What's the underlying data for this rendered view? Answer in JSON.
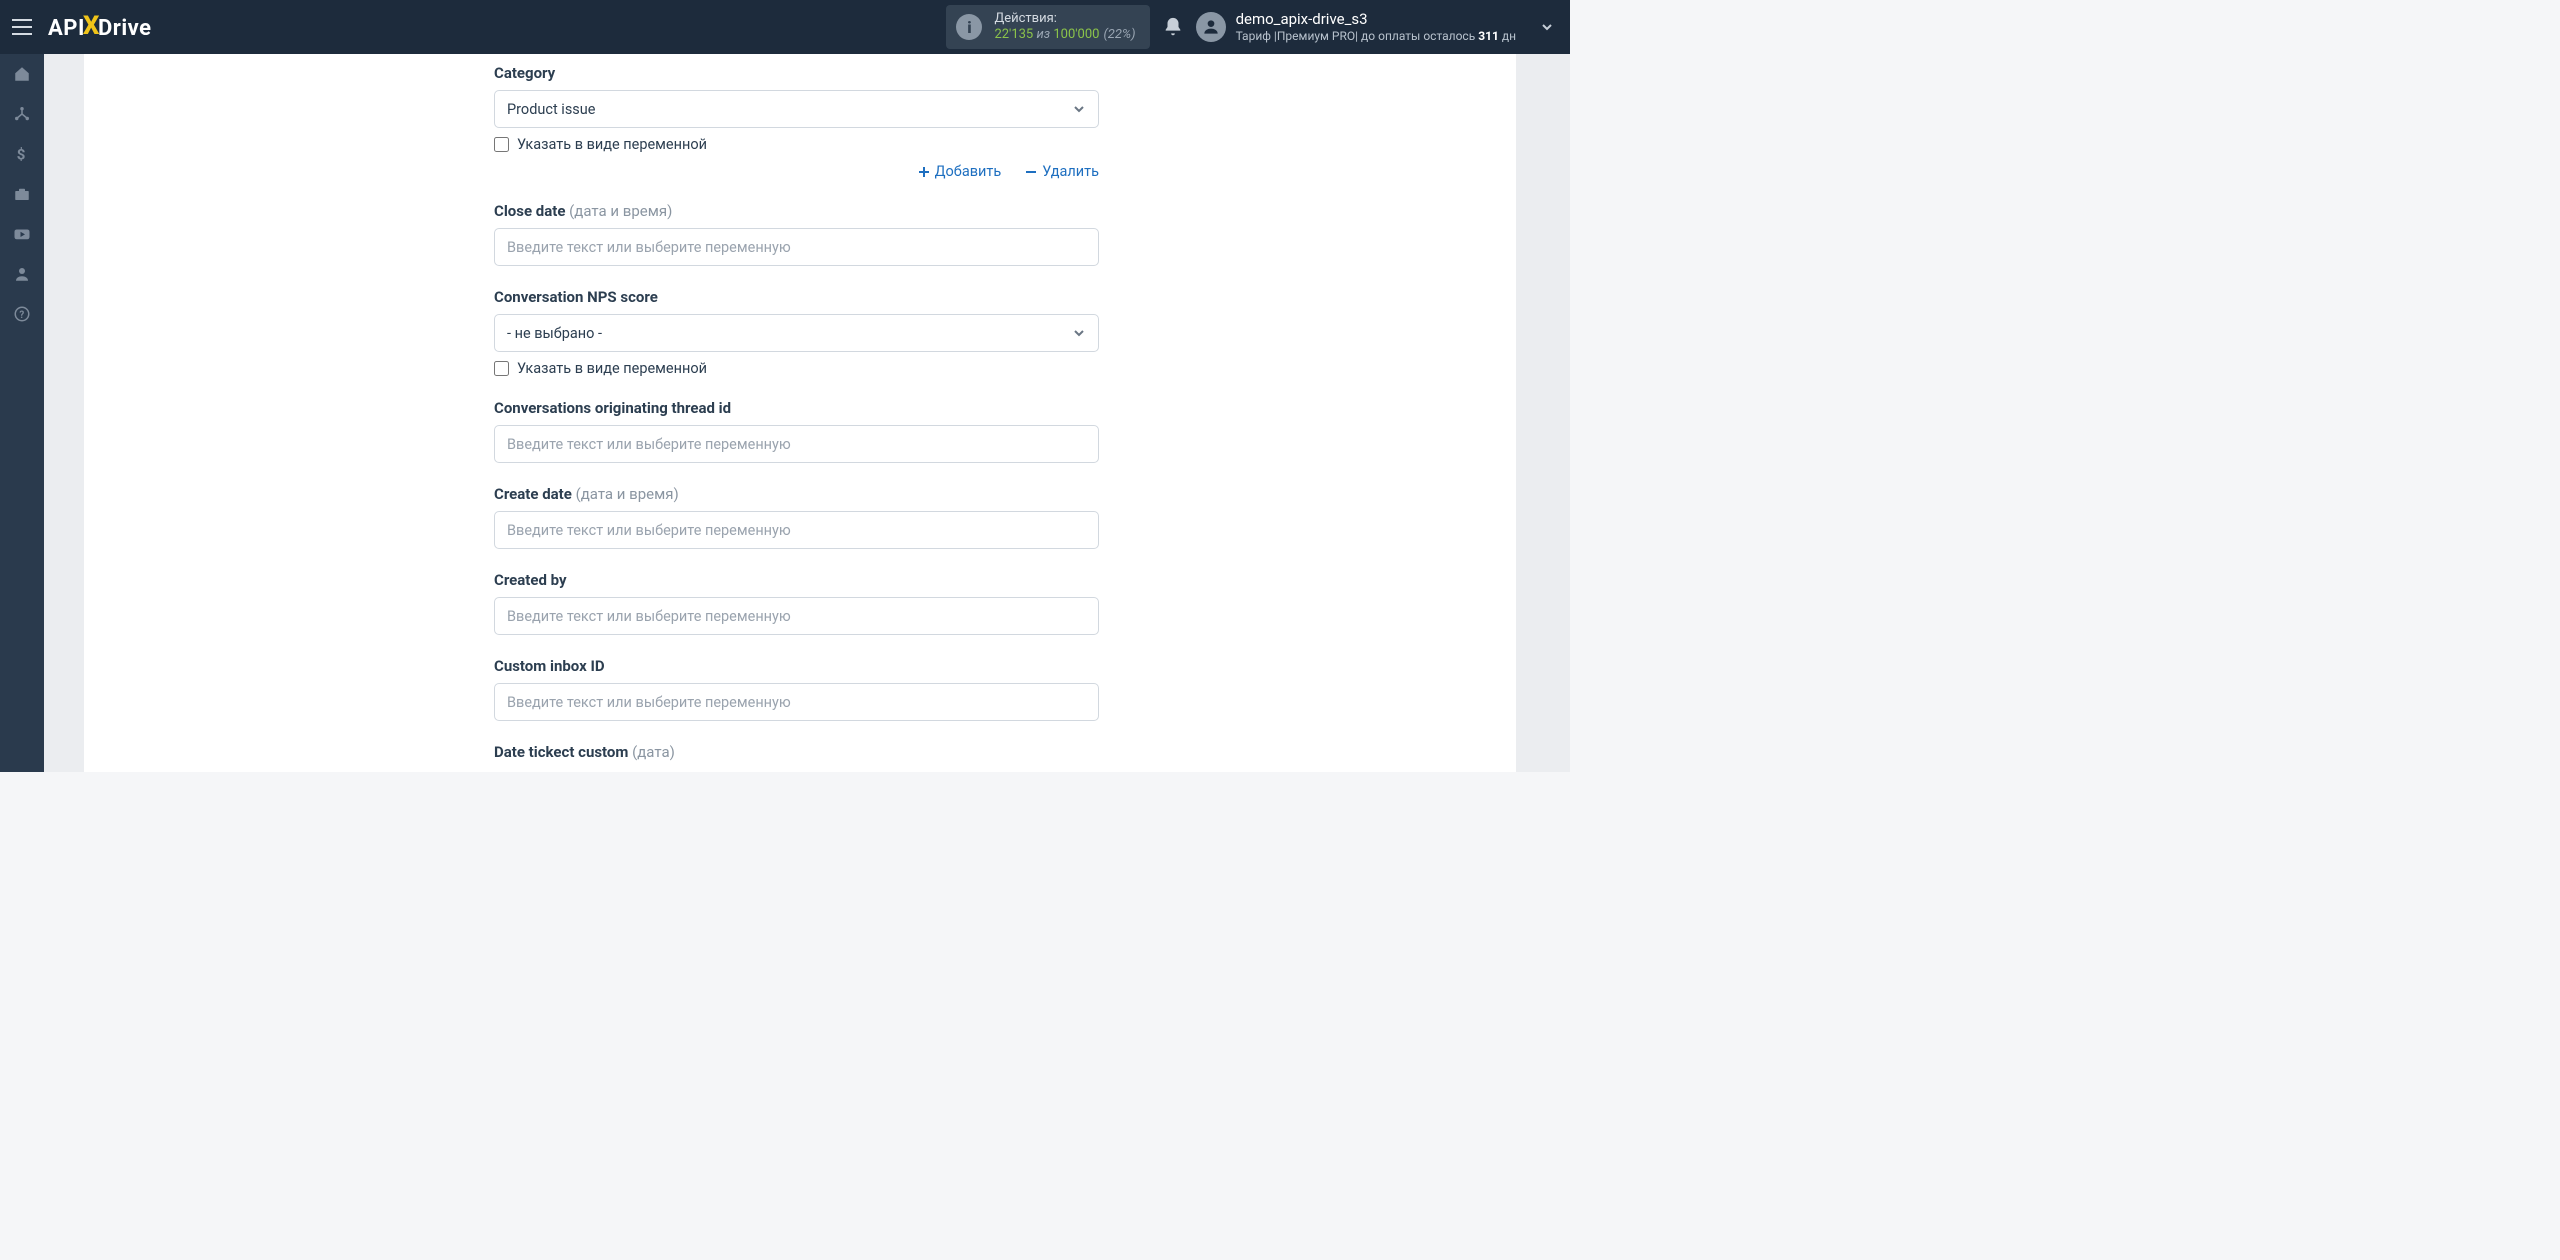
{
  "header": {
    "logo_api": "API",
    "logo_drive": "Drive",
    "usage_label": "Действия:",
    "usage_done": "22'135",
    "usage_of": " из ",
    "usage_total": "100'000",
    "usage_pct": "(22%)",
    "user_name": "demo_apix-drive_s3",
    "tariff_prefix": "Тариф |",
    "tariff_name": "Премиум PRO",
    "tariff_sep": "| ",
    "tariff_tail_a": "до оплаты осталось ",
    "tariff_days": "311",
    "tariff_tail_b": " дн"
  },
  "form": {
    "placeholder_text": "Введите текст или выберите переменную",
    "checkbox_label": "Указать в виде переменной",
    "add_label": "Добавить",
    "delete_label": "Удалить",
    "not_selected": "- не выбрано -",
    "category_label": "Category",
    "category_value": "Product issue",
    "close_date_label": "Close date",
    "close_date_hint": "(дата и время)",
    "nps_label": "Conversation NPS score",
    "thread_label": "Conversations originating thread id",
    "create_date_label": "Create date",
    "create_date_hint": "(дата и время)",
    "created_by_label": "Created by",
    "inbox_label": "Custom inbox ID",
    "date_ticket_label": "Date tickect custom",
    "date_ticket_hint": "(дата)"
  }
}
